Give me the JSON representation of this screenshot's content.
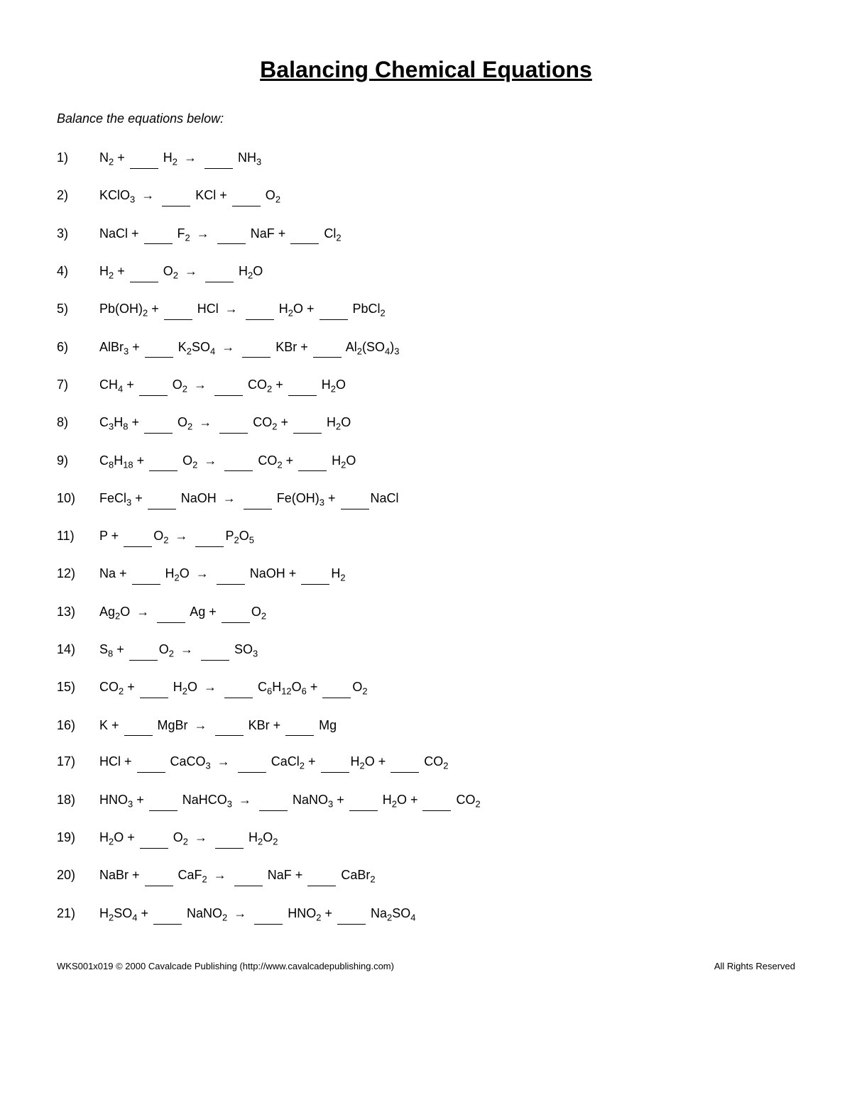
{
  "title": "Balancing Chemical Equations",
  "subtitle": "Balance the equations below:",
  "equations": [
    {
      "number": "1)",
      "html": "N<sub>2</sub> + ____ H<sub>2</sub> → ____ NH<sub>3</sub>"
    },
    {
      "number": "2)",
      "html": "KClO<sub>3</sub> → ____ KCl + ____ O<sub>2</sub>"
    },
    {
      "number": "3)",
      "html": "NaCl + ____ F<sub>2</sub> → ____ NaF + ____ Cl<sub>2</sub>"
    },
    {
      "number": "4)",
      "html": "H<sub>2</sub> + ____ O<sub>2</sub> → ____ H<sub>2</sub>O"
    },
    {
      "number": "5)",
      "html": "Pb(OH)<sub>2</sub> + ____ HCl → ____ H<sub>2</sub>O + ____ PbCl<sub>2</sub>"
    },
    {
      "number": "6)",
      "html": "AlBr<sub>3</sub> + ____ K<sub>2</sub>SO<sub>4</sub> → ____ KBr + ____ Al<sub>2</sub>(SO<sub>4</sub>)<sub>3</sub>"
    },
    {
      "number": "7)",
      "html": "CH<sub>4</sub> + ____ O<sub>2</sub> → ____ CO<sub>2</sub> + ____ H<sub>2</sub>O"
    },
    {
      "number": "8)",
      "html": "C<sub>3</sub>H<sub>8</sub> + ____ O<sub>2</sub> → ____ CO<sub>2</sub> + ____ H<sub>2</sub>O"
    },
    {
      "number": "9)",
      "html": "C<sub>8</sub>H<sub>18</sub> + ____ O<sub>2</sub> → ____ CO<sub>2</sub> + ____ H<sub>2</sub>O"
    },
    {
      "number": "10)",
      "html": "FeCl<sub>3</sub> + ____ NaOH → ____ Fe(OH)<sub>3</sub> + ____NaCl"
    },
    {
      "number": "11)",
      "html": "P + ____O<sub>2</sub> → ____P<sub>2</sub>O<sub>5</sub>"
    },
    {
      "number": "12)",
      "html": "Na + ____ H<sub>2</sub>O → ____ NaOH + ____H<sub>2</sub>"
    },
    {
      "number": "13)",
      "html": "Ag<sub>2</sub>O → ____ Ag + ____O<sub>2</sub>"
    },
    {
      "number": "14)",
      "html": "S<sub>8</sub> + ____O<sub>2</sub> → ____ SO<sub>3</sub>"
    },
    {
      "number": "15)",
      "html": "CO<sub>2</sub> + ____ H<sub>2</sub>O → ____ C<sub>6</sub>H<sub>12</sub>O<sub>6</sub> + ____O<sub>2</sub>"
    },
    {
      "number": "16)",
      "html": "K + ____ MgBr → ____ KBr + ____ Mg"
    },
    {
      "number": "17)",
      "html": "HCl + ____ CaCO<sub>3</sub> → ____ CaCl<sub>2</sub> + ____H<sub>2</sub>O + ____ CO<sub>2</sub>"
    },
    {
      "number": "18)",
      "html": "HNO<sub>3</sub> + ____ NaHCO<sub>3</sub> → ____ NaNO<sub>3</sub> + ____ H<sub>2</sub>O + ____ CO<sub>2</sub>"
    },
    {
      "number": "19)",
      "html": "H<sub>2</sub>O + ____ O<sub>2</sub> → ____ H<sub>2</sub>O<sub>2</sub>"
    },
    {
      "number": "20)",
      "html": "NaBr + ____ CaF<sub>2</sub> → ____ NaF + ____ CaBr<sub>2</sub>"
    },
    {
      "number": "21)",
      "html": "H<sub>2</sub>SO<sub>4</sub> + ____ NaNO<sub>2</sub> → ____ HNO<sub>2</sub> + ____ Na<sub>2</sub>SO<sub>4</sub>"
    }
  ],
  "footer": {
    "left": "WKS001x019  © 2000 Cavalcade Publishing (http://www.cavalcadepublishing.com)",
    "right": "All Rights Reserved"
  }
}
